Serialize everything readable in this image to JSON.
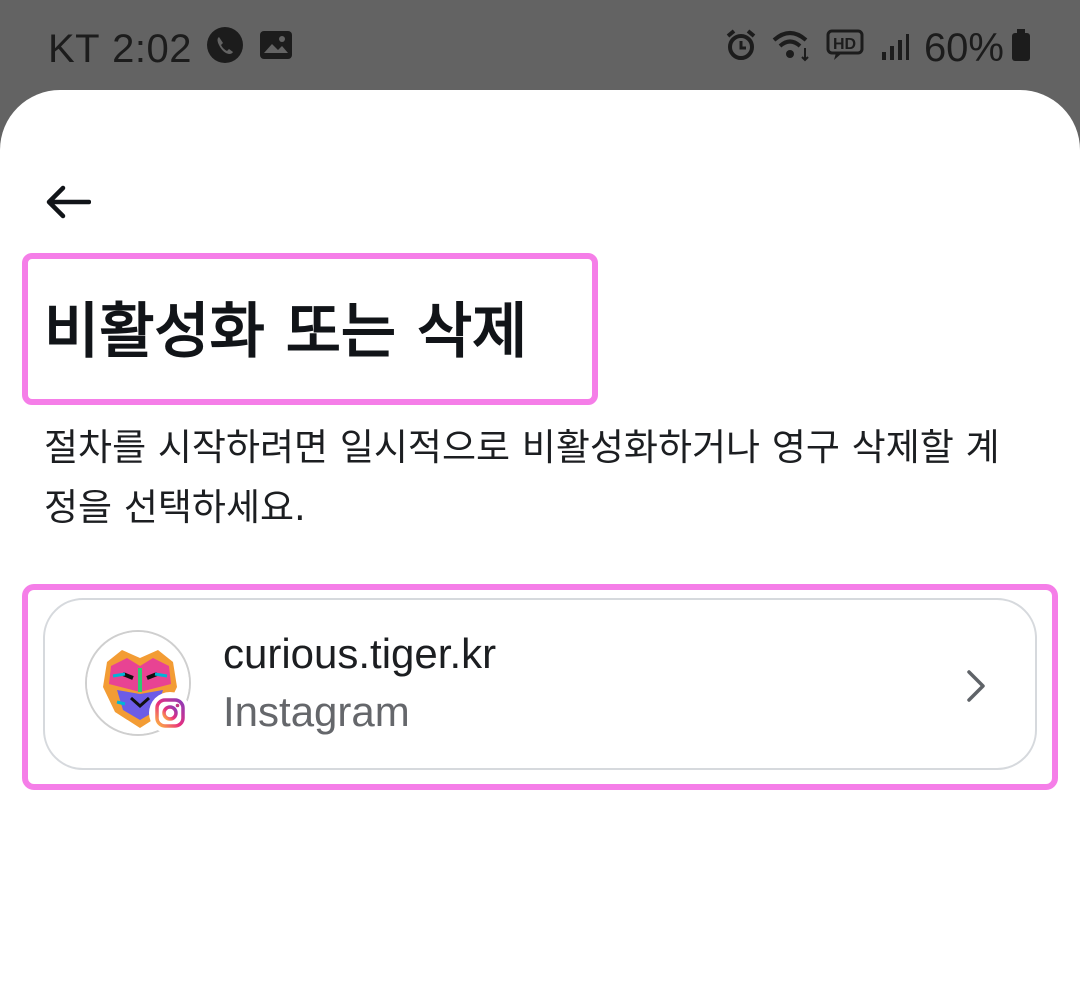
{
  "status_bar": {
    "carrier": "KT",
    "time": "2:02",
    "battery": "60%",
    "icons": [
      "call-icon",
      "gallery-icon",
      "alarm-icon",
      "wifi-icon",
      "hd-voice-icon",
      "signal-icon",
      "battery-icon"
    ]
  },
  "header": {
    "back_icon": "back-arrow-icon",
    "title": "비활성화 또는 삭제",
    "description": "절차를 시작하려면 일시적으로 비활성화하거나 영구 삭제할 계정을 선택하세요."
  },
  "accounts": [
    {
      "username": "curious.tiger.kr",
      "platform": "Instagram",
      "badge_icon": "instagram-icon",
      "chevron_icon": "chevron-right-icon"
    }
  ],
  "colors": {
    "highlight": "#f57ee8",
    "text_primary": "#1c1e21",
    "text_secondary": "#65676b",
    "card_border": "#d6d9dd"
  }
}
